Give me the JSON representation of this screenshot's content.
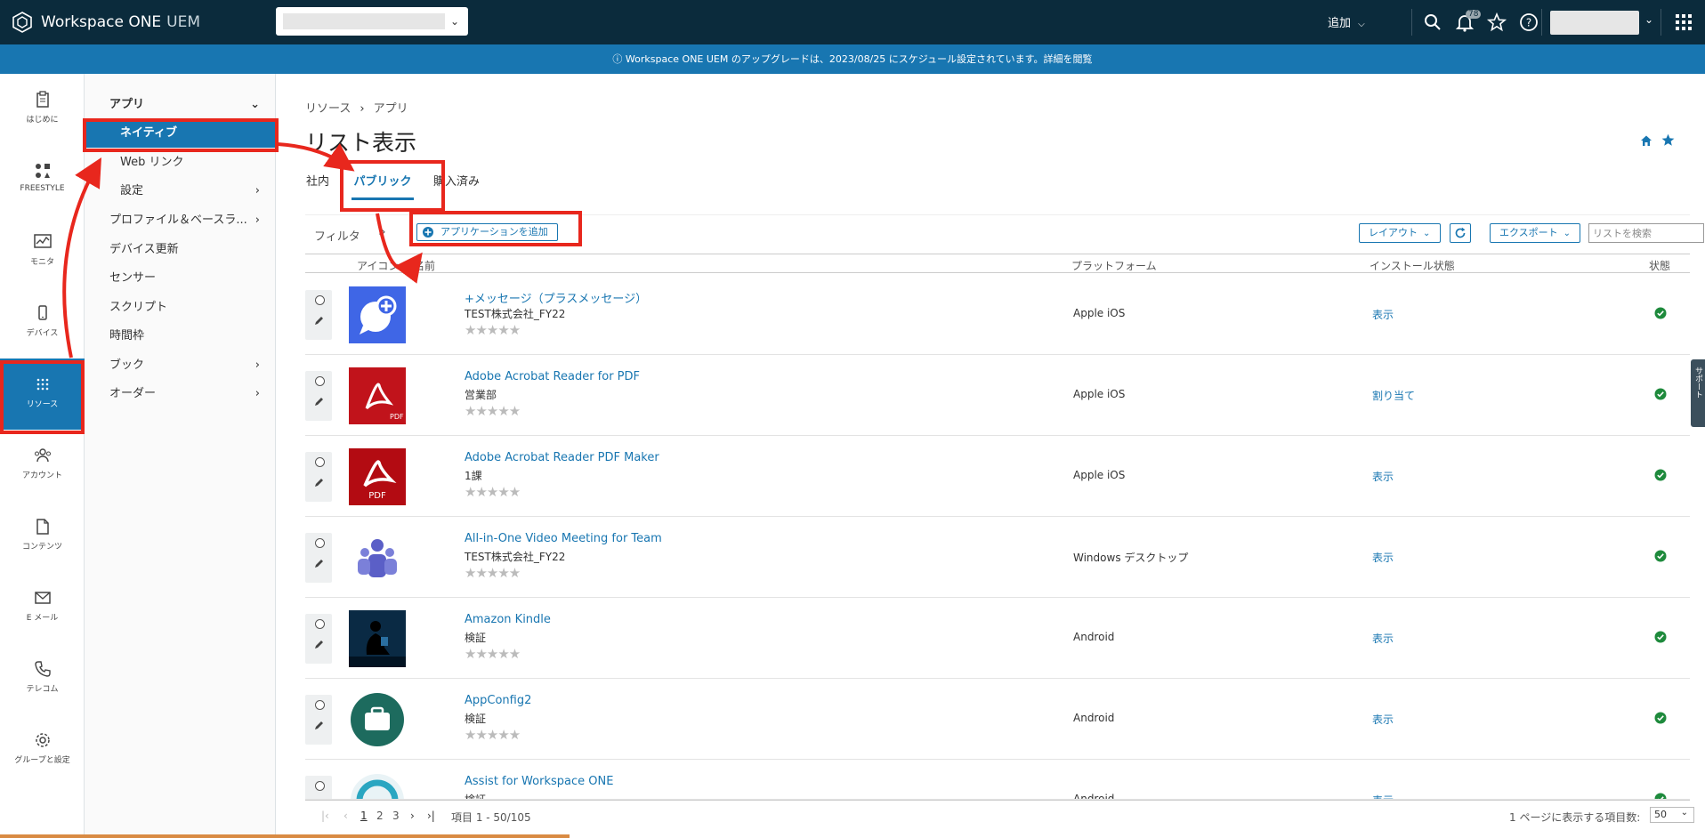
{
  "header": {
    "brand": "Workspace ONE",
    "brand_suffix": "UEM",
    "add_menu": "追加",
    "notification_count": "78"
  },
  "announcement": "Workspace ONE UEM のアップグレードは、2023/08/25 にスケジュール設定されています。詳細を閲覧",
  "leftnav": [
    {
      "label": "はじめに",
      "icon": "clipboard-icon"
    },
    {
      "label": "FREESTYLE",
      "icon": "freestyle-icon"
    },
    {
      "label": "モニタ",
      "icon": "monitor-icon"
    },
    {
      "label": "デバイス",
      "icon": "device-icon"
    },
    {
      "label": "リソース",
      "icon": "grid-icon"
    },
    {
      "label": "アカウント",
      "icon": "accounts-icon"
    },
    {
      "label": "コンテンツ",
      "icon": "content-icon"
    },
    {
      "label": "E メール",
      "icon": "mail-icon"
    },
    {
      "label": "テレコム",
      "icon": "phone-icon"
    },
    {
      "label": "グループと設定",
      "icon": "gear-icon"
    }
  ],
  "subnav": {
    "section": "アプリ",
    "items": [
      "ネイティブ",
      "Web リンク",
      "設定"
    ],
    "groups": [
      "プロファイル＆ベースラ...",
      "デバイス更新",
      "センサー",
      "スクリプト",
      "時間枠",
      "ブック",
      "オーダー"
    ]
  },
  "breadcrumb": [
    "リソース",
    "アプリ"
  ],
  "page_title": "リスト表示",
  "tabs": [
    "社内",
    "パブリック",
    "購入済み"
  ],
  "toolbar": {
    "filter": "フィルタ",
    "add_app": "アプリケーションを追加",
    "layout": "レイアウト",
    "export": "エクスポート",
    "search_placeholder": "リストを検索"
  },
  "columns": [
    "アイコン",
    "名前",
    "プラットフォーム",
    "インストール状態",
    "状態"
  ],
  "rows": [
    {
      "name": "+メッセージ（プラスメッセージ）",
      "org": "TEST株式会社_FY22",
      "platform": "Apple iOS",
      "install": "表示",
      "icon": "plus-message-icon"
    },
    {
      "name": "Adobe Acrobat Reader for PDF",
      "org": "営業部",
      "platform": "Apple iOS",
      "install": "割り当て",
      "icon": "acrobat-icon"
    },
    {
      "name": "Adobe Acrobat Reader PDF Maker",
      "org": "1課",
      "platform": "Apple iOS",
      "install": "表示",
      "icon": "acrobat-icon"
    },
    {
      "name": "All-in-One Video Meeting for Team",
      "org": "TEST株式会社_FY22",
      "platform": "Windows デスクトップ",
      "install": "表示",
      "icon": "teams-icon"
    },
    {
      "name": "Amazon Kindle",
      "org": "検証",
      "platform": "Android",
      "install": "表示",
      "icon": "kindle-icon"
    },
    {
      "name": "AppConfig2",
      "org": "検証",
      "platform": "Android",
      "install": "表示",
      "icon": "briefcase-icon"
    },
    {
      "name": "Assist for Workspace ONE",
      "org": "検証",
      "platform": "Android",
      "install": "表示",
      "icon": "assist-icon"
    }
  ],
  "stars": "★★★★★",
  "pager": {
    "pages": [
      "1",
      "2",
      "3"
    ],
    "range": "項目 1 - 50/105",
    "per_page_label": "1 ページに表示する項目数:",
    "per_page": "50"
  },
  "support_tab": "サポート",
  "colors": {
    "topbar": "#0b2b3c",
    "accent": "#1876b1",
    "annotation": "#e8271d",
    "success": "#1e8a3c"
  }
}
